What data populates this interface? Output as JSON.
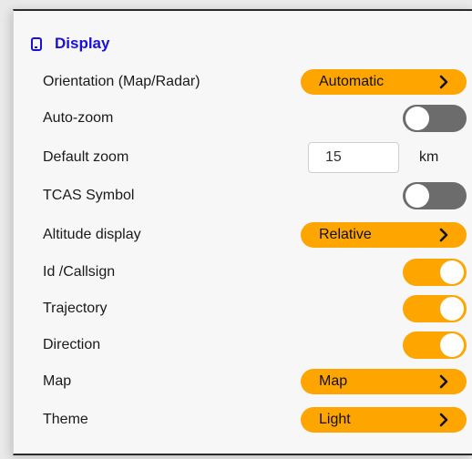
{
  "section": {
    "title": "Display",
    "icon": "mobile-device-icon",
    "accent_color": "#1a10d8"
  },
  "colors": {
    "orange": "#ffa500",
    "toggle_off": "#6c6c6c"
  },
  "settings": {
    "orientation": {
      "label": "Orientation (Map/Radar)",
      "value": "Automatic"
    },
    "auto_zoom": {
      "label": "Auto-zoom",
      "state": "off"
    },
    "default_zoom": {
      "label": "Default zoom",
      "value": "15",
      "unit": "km"
    },
    "tcas_symbol": {
      "label": "TCAS Symbol",
      "state": "off"
    },
    "altitude_display": {
      "label": "Altitude display",
      "value": "Relative"
    },
    "id_callsign": {
      "label": "Id /Callsign",
      "state": "on"
    },
    "trajectory": {
      "label": "Trajectory",
      "state": "on"
    },
    "direction": {
      "label": "Direction",
      "state": "on"
    },
    "map": {
      "label": "Map",
      "value": "Map"
    },
    "theme": {
      "label": "Theme",
      "value": "Light"
    }
  }
}
